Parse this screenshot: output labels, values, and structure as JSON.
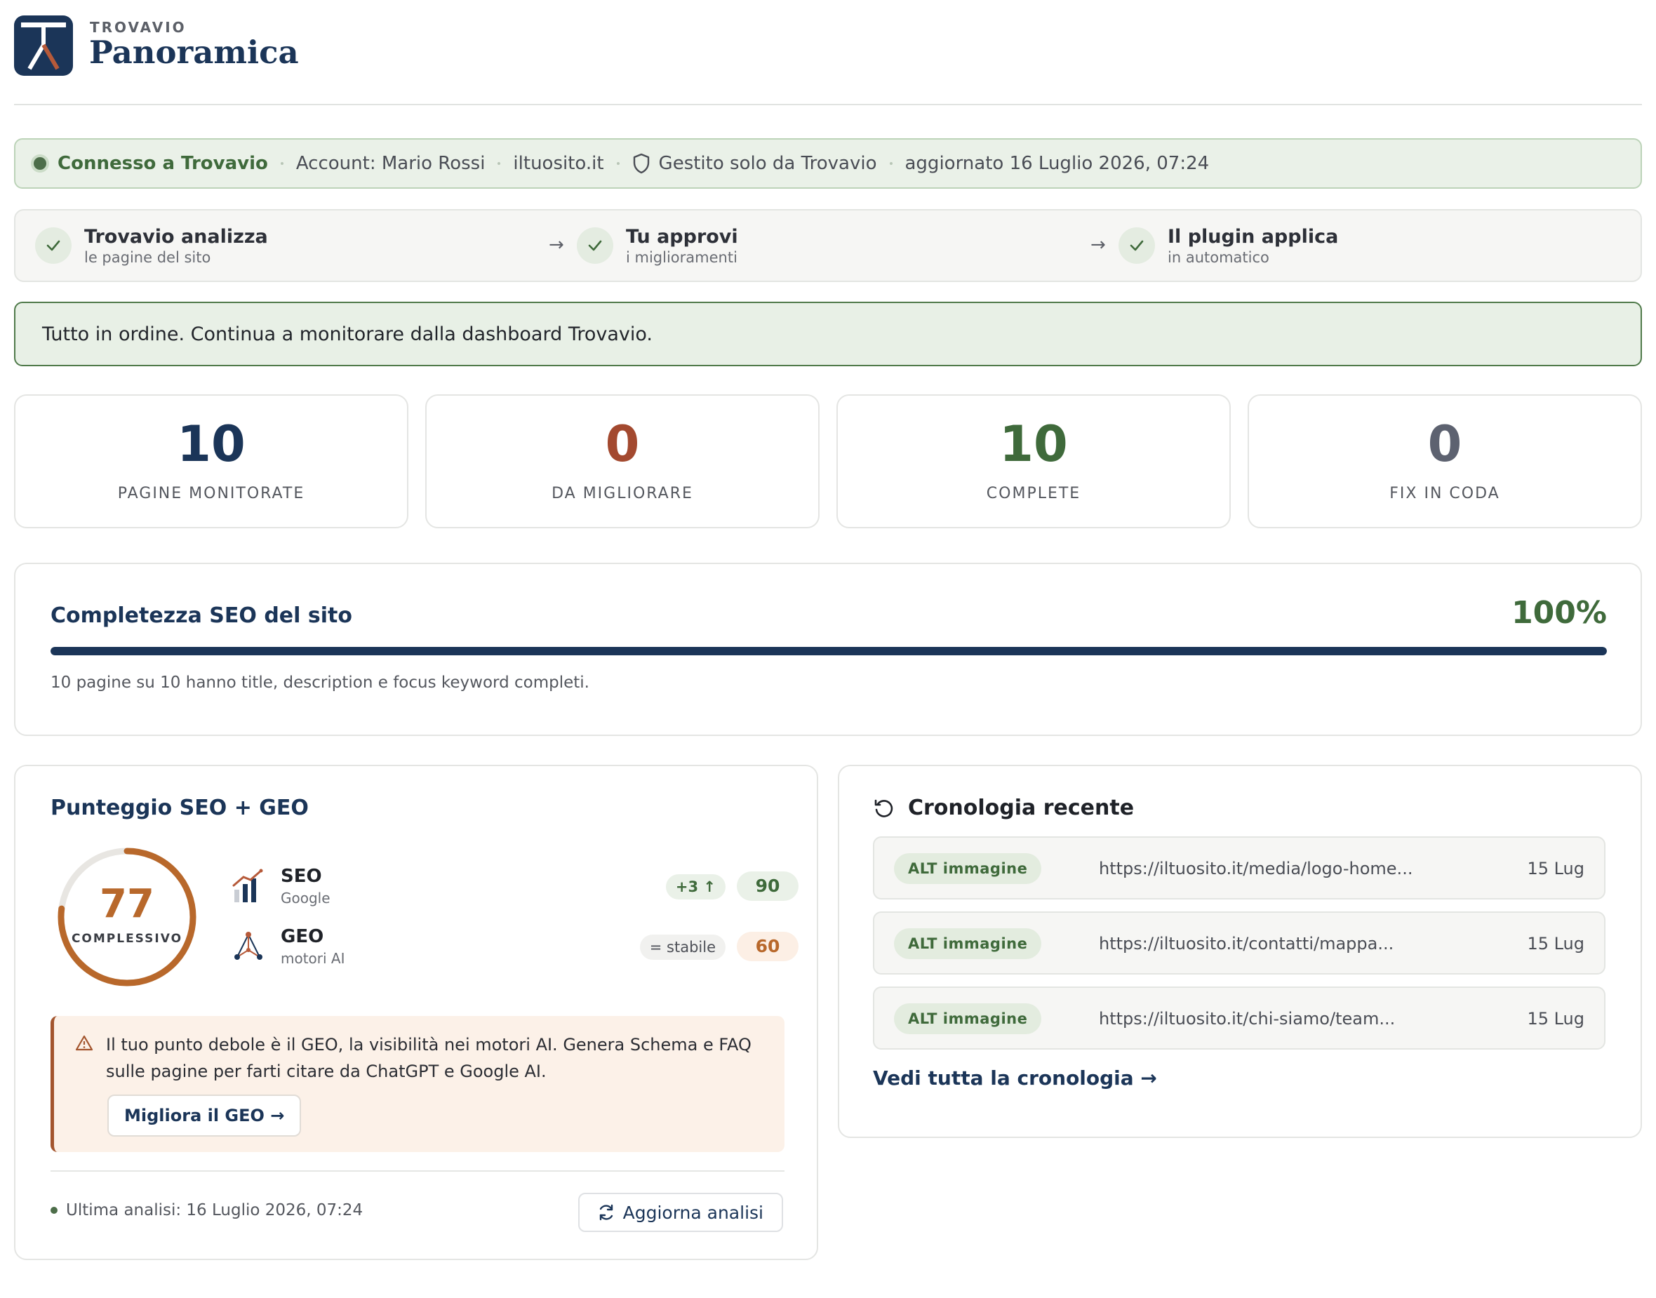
{
  "header": {
    "brand": "TROVAVIO",
    "title": "Panoramica"
  },
  "status": {
    "connected": "Connesso a Trovavio",
    "account": "Account: Mario Rossi",
    "site": "iltuosito.it",
    "managed": "Gestito solo da Trovavio",
    "updated": "aggiornato 16 Luglio 2026, 07:24"
  },
  "steps": [
    {
      "title": "Trovavio analizza",
      "sub": "le pagine del sito"
    },
    {
      "title": "Tu approvi",
      "sub": "i miglioramenti"
    },
    {
      "title": "Il plugin applica",
      "sub": "in automatico"
    }
  ],
  "banner": "Tutto in ordine. Continua a monitorare dalla dashboard Trovavio.",
  "stats": [
    {
      "value": "10",
      "label": "PAGINE MONITORATE",
      "color": "#1b3558"
    },
    {
      "value": "0",
      "label": "DA MIGLIORARE",
      "color": "#a3492f"
    },
    {
      "value": "10",
      "label": "COMPLETE",
      "color": "#3f6a3b"
    },
    {
      "value": "0",
      "label": "FIX IN CODA",
      "color": "#5d6270"
    }
  ],
  "completeness": {
    "title": "Completezza SEO del sito",
    "percent_label": "100%",
    "percent": 100,
    "note": "10 pagine su 10 hanno title, description e focus keyword completi."
  },
  "score": {
    "title": "Punteggio SEO + GEO",
    "overall": "77",
    "overall_value": 77,
    "overall_caption": "COMPLESSIVO",
    "metrics": [
      {
        "name": "SEO",
        "sub": "Google",
        "trend": "+3 ↑",
        "value": "90",
        "icon": "bar-chart-icon"
      },
      {
        "name": "GEO",
        "sub": "motori AI",
        "trend": "= stabile",
        "value": "60",
        "icon": "network-icon"
      }
    ],
    "alert": {
      "message": "Il tuo punto debole è il GEO, la visibilità nei motori AI. Genera Schema e FAQ sulle pagine per farti citare da ChatGPT e Google AI.",
      "button": "Migliora il GEO →"
    },
    "last_analysis": "Ultima analisi: 16 Luglio 2026, 07:24",
    "refresh_button": "Aggiorna analisi"
  },
  "history": {
    "title": "Cronologia recente",
    "rows": [
      {
        "badge": "ALT immagine",
        "url": "https://iltuosito.it/media/logo-home...",
        "date": "15 Lug"
      },
      {
        "badge": "ALT immagine",
        "url": "https://iltuosito.it/contatti/mappa...",
        "date": "15 Lug"
      },
      {
        "badge": "ALT immagine",
        "url": "https://iltuosito.it/chi-siamo/team...",
        "date": "15 Lug"
      }
    ],
    "link": "Vedi tutta la cronologia →"
  },
  "colors": {
    "brand_navy": "#1b3558",
    "success_green": "#3f6a3b",
    "warning_orange": "#b8682b",
    "alert_rust": "#a3552e"
  }
}
